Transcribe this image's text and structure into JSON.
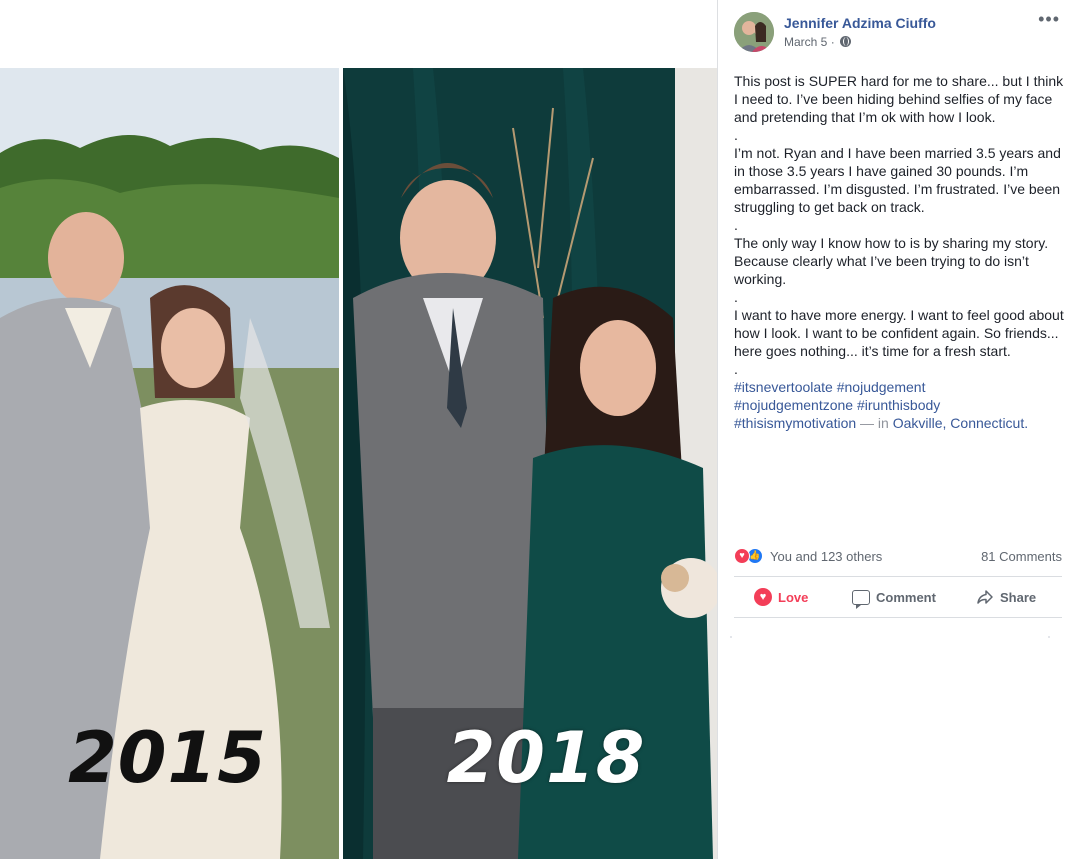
{
  "photo": {
    "left_caption": "2015",
    "right_caption": "2018"
  },
  "post": {
    "author": "Jennifer Adzima Ciuffo",
    "date": "March 5",
    "date_sep": " · ",
    "paragraphs": [
      "This post is SUPER hard for me to share... but I think I need to. I’ve been hiding behind selfies of my face and pretending that I’m ok with how I look.",
      ".",
      "I’m not. Ryan and I have been married 3.5 years and in those 3.5 years I have gained 30 pounds. I’m embarrassed. I’m disgusted. I’m frustrated. I’ve been struggling to get back on track.",
      ".",
      "The only way I know how to is by sharing my story. Because clearly what I’ve been trying to do isn’t working.",
      ".",
      "I want to have more energy. I want to feel good about how I look. I want to be confident again. So friends... here goes nothing... it’s time for a fresh start.",
      "."
    ],
    "hashtags": [
      "#itsnevertoolate",
      "#nojudgement",
      "#nojudgementzone",
      "#irunthisbody",
      "#thisismymotivation"
    ],
    "location_sep": " — in ",
    "location": "Oakville, Connecticut."
  },
  "reactions": {
    "text": "You and 123 others",
    "comments": "81 Comments"
  },
  "actions": {
    "love": "Love",
    "comment": "Comment",
    "share": "Share"
  },
  "colors": {
    "link": "#385898",
    "love": "#f33e58",
    "like": "#2078f4",
    "muted": "#606770"
  },
  "icons": {
    "more": "more-icon",
    "privacy": "globe-icon",
    "love": "heart-icon",
    "comment": "comment-icon",
    "share": "share-icon"
  }
}
